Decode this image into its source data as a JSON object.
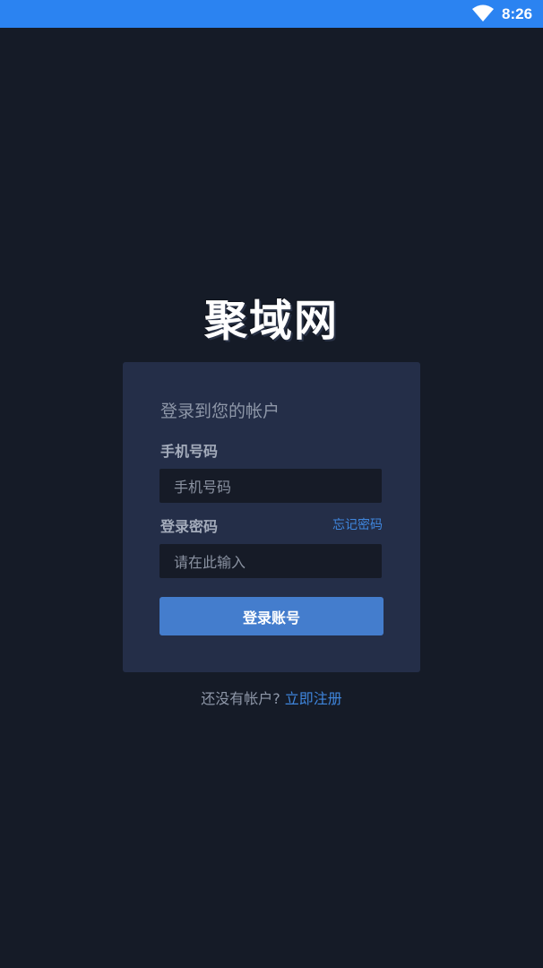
{
  "status_bar": {
    "time": "8:26",
    "bg_color": "#2b83f1",
    "icons": [
      "wifi-icon"
    ]
  },
  "logo": {
    "text": "聚域网"
  },
  "login_card": {
    "title": "登录到您的帐户",
    "phone_label": "手机号码",
    "phone_placeholder": "手机号码",
    "password_label": "登录密码",
    "forgot_password": "忘记密码",
    "password_placeholder": "请在此输入",
    "login_button": "登录账号",
    "button_color": "#447dcd"
  },
  "register": {
    "prompt": "还没有帐户?",
    "link": "立即注册",
    "link_color": "#3f86dd"
  },
  "colors": {
    "background": "#151b27",
    "card": "#242e48",
    "input": "#161b27"
  }
}
